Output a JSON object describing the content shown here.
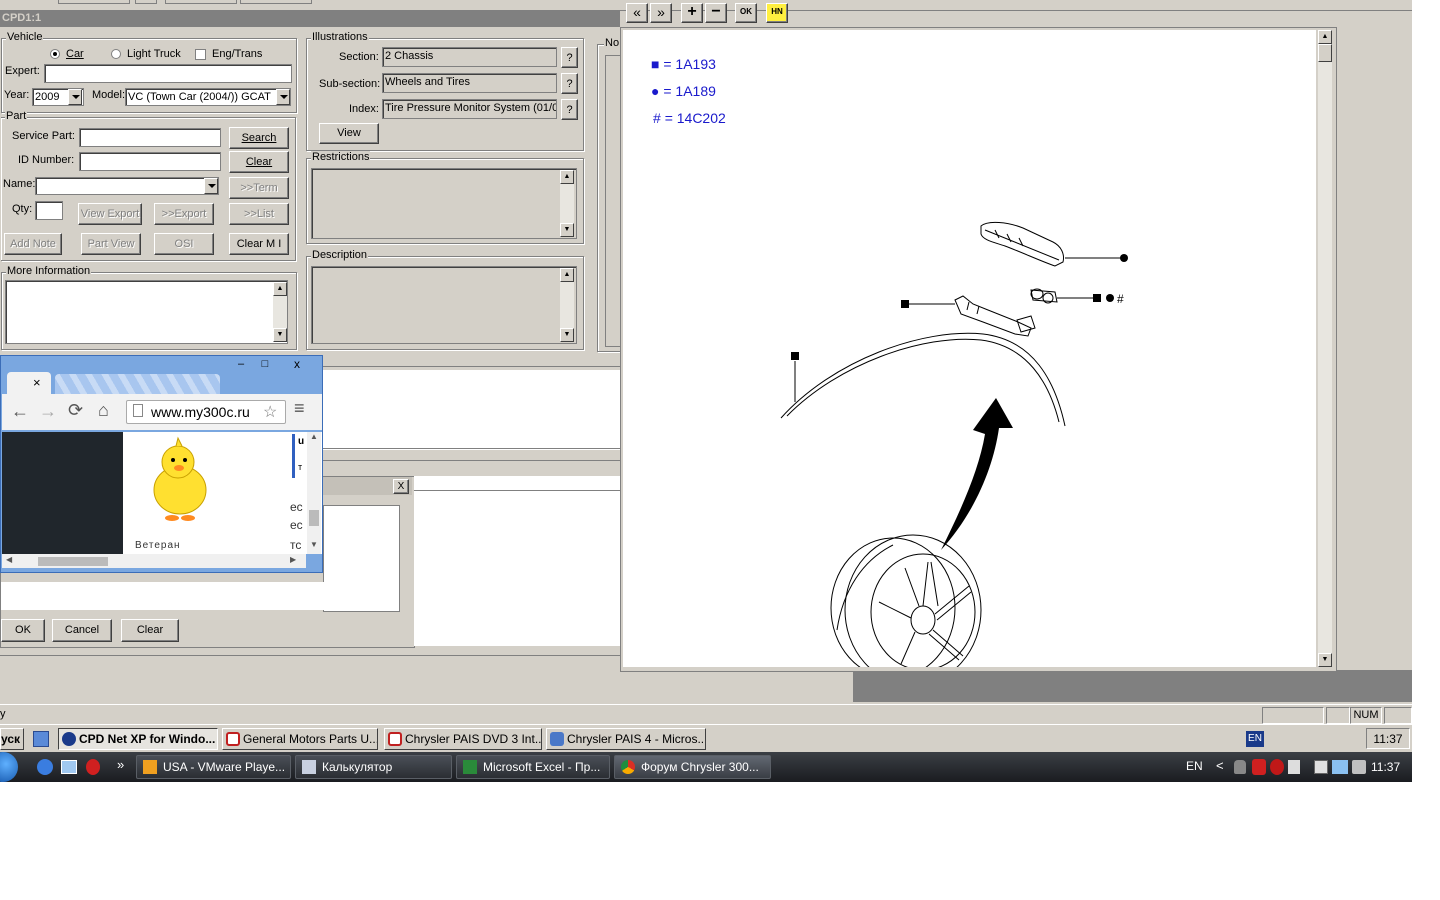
{
  "window": {
    "title": "CPD1:1"
  },
  "vehicle": {
    "group_label": "Vehicle",
    "car_label": "Car",
    "light_truck_label": "Light Truck",
    "eng_trans_label": "Eng/Trans",
    "expert_label": "Expert:",
    "expert_value": "",
    "year_label": "Year:",
    "year_value": "2009",
    "model_label": "Model:",
    "model_value": "VC (Town Car (2004/)) GCAT"
  },
  "part": {
    "group_label": "Part",
    "service_part_label": "Service Part:",
    "id_number_label": "ID Number:",
    "name_label": "Name:",
    "qty_label": "Qty:",
    "search_btn": "Search",
    "clear_btn": "Clear",
    "term_btn": ">>Term",
    "view_export_btn": "View Export",
    "export_btn": ">>Export",
    "list_btn": ">>List",
    "add_note_btn": "Add Note",
    "part_view_btn": "Part View",
    "osi_btn": "OSI",
    "clear_mi_btn": "Clear M I"
  },
  "more_info": {
    "group_label": "More Information"
  },
  "illustrations": {
    "group_label": "Illustrations",
    "section_label": "Section:",
    "section_value": "2  Chassis",
    "subsection_label": "Sub-section:",
    "subsection_value": "Wheels and Tires",
    "index_label": "Index:",
    "index_value": "Tire Pressure Monitor System  (01/0",
    "help_btn": "?",
    "view_btn": "View"
  },
  "restrictions": {
    "group_label": "Restrictions"
  },
  "description": {
    "group_label": "Description"
  },
  "notes_group_label": "No",
  "dialog": {
    "ok_btn": "OK",
    "cancel_btn": "Cancel",
    "clear_btn": "Clear",
    "close_glyph": "X"
  },
  "viewer": {
    "toolbar": {
      "prev": "«",
      "next": "»",
      "zoom_in": "+",
      "zoom_out": "−",
      "ok_label": "OK",
      "hn_label": "HN"
    },
    "legend": [
      {
        "symbol": "■",
        "text": "= 1A193"
      },
      {
        "symbol": "●",
        "text": "= 1A189"
      },
      {
        "symbol": "#",
        "text": "= 14C202"
      }
    ],
    "callout_hash": "#"
  },
  "chrome_popup": {
    "tab_close": "×",
    "url": "www.my300c.ru",
    "user_rank": "Ветеран",
    "frag1": "u",
    "frag2": "т",
    "frag3": "ec",
    "frag4": "ec",
    "frag5": "тс",
    "win_min": "‒",
    "win_max": "□",
    "win_close": "x"
  },
  "status_bar": {
    "left_text": "y",
    "num_label": "NUM"
  },
  "guest_taskbar": {
    "start_label": "уск",
    "items": [
      "CPD Net XP for Windo...",
      "General Motors Parts U....",
      "Chrysler PAIS DVD 3 Int...",
      "Chrysler PAIS 4 - Micros..."
    ],
    "lang": "EN",
    "clock": "11:37"
  },
  "host_taskbar": {
    "more_glyph": "»",
    "items": [
      "USA - VMware Playe...",
      "Калькулятор",
      "Microsoft Excel - Пр...",
      "Форум Chrysler 300..."
    ],
    "lang": "EN",
    "tray_arrow": "<",
    "clock": "11:37"
  },
  "colors": {
    "legend_blue": "#1a1acc",
    "window_gray": "#d4d0c8",
    "titlebar": "#808080"
  }
}
